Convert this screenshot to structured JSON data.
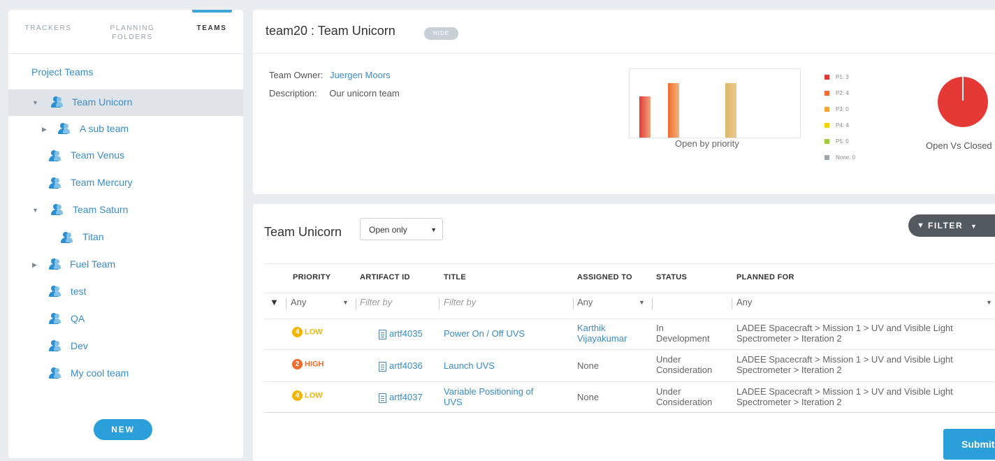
{
  "sidebar": {
    "tabs": [
      {
        "label_line1": "TRACKERS",
        "label_line2": ""
      },
      {
        "label_line1": "PLANNING",
        "label_line2": "FOLDERS"
      },
      {
        "label_line1": "TEAMS",
        "label_line2": ""
      }
    ],
    "section_title": "Project Teams",
    "items": [
      {
        "label": "Team Unicorn"
      },
      {
        "label": "A sub team"
      },
      {
        "label": "Team Venus"
      },
      {
        "label": "Team Mercury"
      },
      {
        "label": "Team Saturn"
      },
      {
        "label": "Titan"
      },
      {
        "label": "Fuel Team"
      },
      {
        "label": "test"
      },
      {
        "label": "QA"
      },
      {
        "label": "Dev"
      },
      {
        "label": "My cool team"
      }
    ],
    "new_label": "NEW"
  },
  "details": {
    "title": "team20 : Team Unicorn",
    "hide_label": "HIDE",
    "owner_label": "Team Owner:",
    "owner_value": "Juergen Moors",
    "description_label": "Description:",
    "description_value": "Our unicorn team",
    "priority_chart_caption": "Open by priority",
    "pie_caption": "Open Vs Closed",
    "legend": [
      {
        "label": "P1: 3",
        "color": "#e53935"
      },
      {
        "label": "P2: 4",
        "color": "#f06b2e"
      },
      {
        "label": "P3: 0",
        "color": "#f7a436"
      },
      {
        "label": "P4: 4",
        "color": "#f5d200"
      },
      {
        "label": "P5: 0",
        "color": "#9ccc3c"
      },
      {
        "label": "None: 0",
        "color": "#9ea7ad"
      }
    ]
  },
  "chart_data": {
    "type": "bar",
    "categories": [
      "P1",
      "P2",
      "P3",
      "P4",
      "P5",
      "None"
    ],
    "values": [
      3,
      4,
      0,
      4,
      0,
      0
    ],
    "title": "Open by priority",
    "colors": [
      "#e53935",
      "#f06b2e",
      "#f7a436",
      "#e0b56a",
      "#9ccc3c",
      "#9ea7ad"
    ]
  },
  "table_panel": {
    "title": "Team Unicorn",
    "view_select": "Open only",
    "filter_label": "FILTER",
    "columns": [
      "PRIORITY",
      "ARTIFACT ID",
      "TITLE",
      "ASSIGNED TO",
      "STATUS",
      "PLANNED FOR"
    ],
    "filters": {
      "priority": "Any",
      "artifact_id": "Filter by",
      "title": "Filter by",
      "assigned": "Any",
      "planned": "Any"
    },
    "rows": [
      {
        "priority_num": "4",
        "priority_label": "LOW",
        "priority_color": "#f2b600",
        "id": "artf4035",
        "title_line1": "Power On / Off UVS",
        "title_line2": "",
        "assigned_line1": "Karthik",
        "assigned_line2": "Vijayakumar",
        "status_line1": "In",
        "status_line2": "Development",
        "planned_line1": "LADEE Spacecraft > Mission 1 > UV and Visible Light",
        "planned_line2": "Spectrometer > Iteration 2"
      },
      {
        "priority_num": "2",
        "priority_label": "HIGH",
        "priority_color": "#f06b2e",
        "id": "artf4036",
        "title_line1": "Launch UVS",
        "title_line2": "",
        "assigned_line1": "None",
        "assigned_line2": "",
        "status_line1": "Under",
        "status_line2": "Consideration",
        "planned_line1": "LADEE Spacecraft > Mission 1 > UV and Visible Light",
        "planned_line2": "Spectrometer > Iteration 2"
      },
      {
        "priority_num": "4",
        "priority_label": "LOW",
        "priority_color": "#f2b600",
        "id": "artf4037",
        "title_line1": "Variable Positioning of",
        "title_line2": "UVS",
        "assigned_line1": "None",
        "assigned_line2": "",
        "status_line1": "Under",
        "status_line2": "Consideration",
        "planned_line1": "LADEE Spacecraft > Mission 1 > UV and Visible Light",
        "planned_line2": "Spectrometer > Iteration 2"
      }
    ],
    "submit_label": "Submit"
  }
}
